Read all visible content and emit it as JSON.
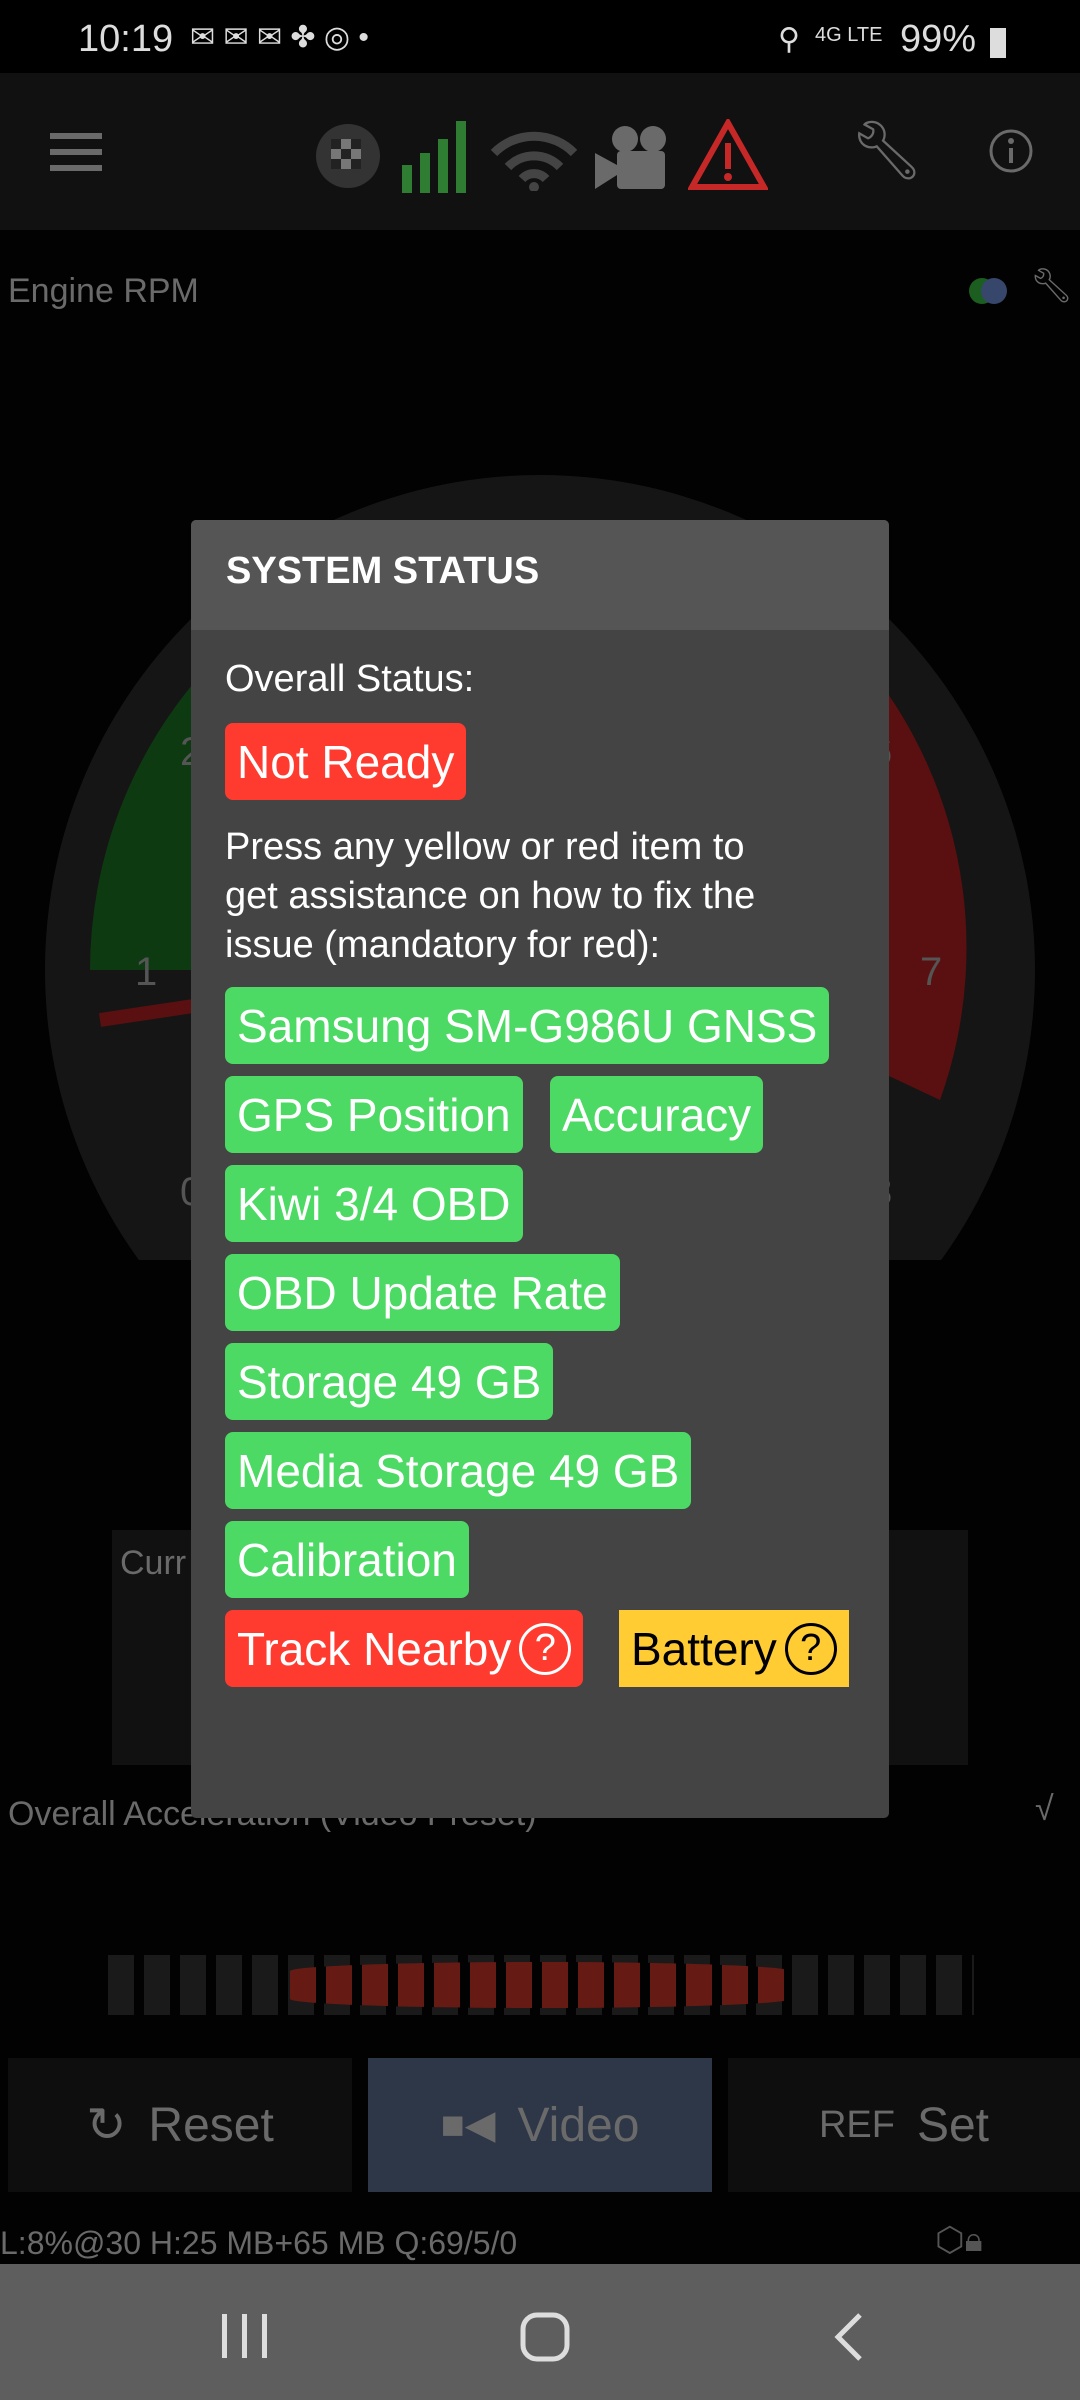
{
  "status_bar": {
    "time": "10:19",
    "network": "4G LTE",
    "battery": "99%"
  },
  "toolbar": {
    "icons": [
      "menu-icon",
      "checkered-flag-icon",
      "signal-bars-icon",
      "wifi-icon",
      "video-camera-icon",
      "warning-icon",
      "wrench-icon",
      "info-icon"
    ],
    "signal_color": "#2e7d32",
    "warning_color": "#c62828"
  },
  "gauge": {
    "title": "Engine RPM",
    "tick_labels": [
      "1",
      "2",
      "6",
      "7",
      "0",
      "8"
    ]
  },
  "current_label": "Curr",
  "accel": {
    "title": "Overall Acceleration (Video Preset)"
  },
  "buttons": {
    "reset": "Reset",
    "video": "Video",
    "ref": "REF",
    "set": "Set"
  },
  "footer": {
    "stats": "L:8%@30 H:25 MB+65 MB Q:69/5/0"
  },
  "dialog": {
    "title": "SYSTEM STATUS",
    "overall_label": "Overall Status:",
    "overall_value": "Not Ready",
    "instructions": [
      "Press any yellow or red item to",
      "get assistance on how to fix the",
      "issue (mandatory for red):"
    ],
    "items": [
      {
        "label": "Samsung SM-G986U GNSS",
        "status": "green"
      },
      {
        "label": "GPS Position",
        "status": "green"
      },
      {
        "label": "Accuracy",
        "status": "green"
      },
      {
        "label": "Kiwi 3/4 OBD",
        "status": "green"
      },
      {
        "label": "OBD Update Rate",
        "status": "green"
      },
      {
        "label": "Storage 49 GB",
        "status": "green"
      },
      {
        "label": "Media Storage 49 GB",
        "status": "green"
      },
      {
        "label": "Calibration",
        "status": "green"
      },
      {
        "label": "Track Nearby",
        "status": "red",
        "help": "?"
      },
      {
        "label": "Battery",
        "status": "yellow",
        "help": "?"
      }
    ],
    "colors": {
      "green": "#4cd964",
      "red": "#ff3b30",
      "yellow": "#ffcc33"
    }
  }
}
